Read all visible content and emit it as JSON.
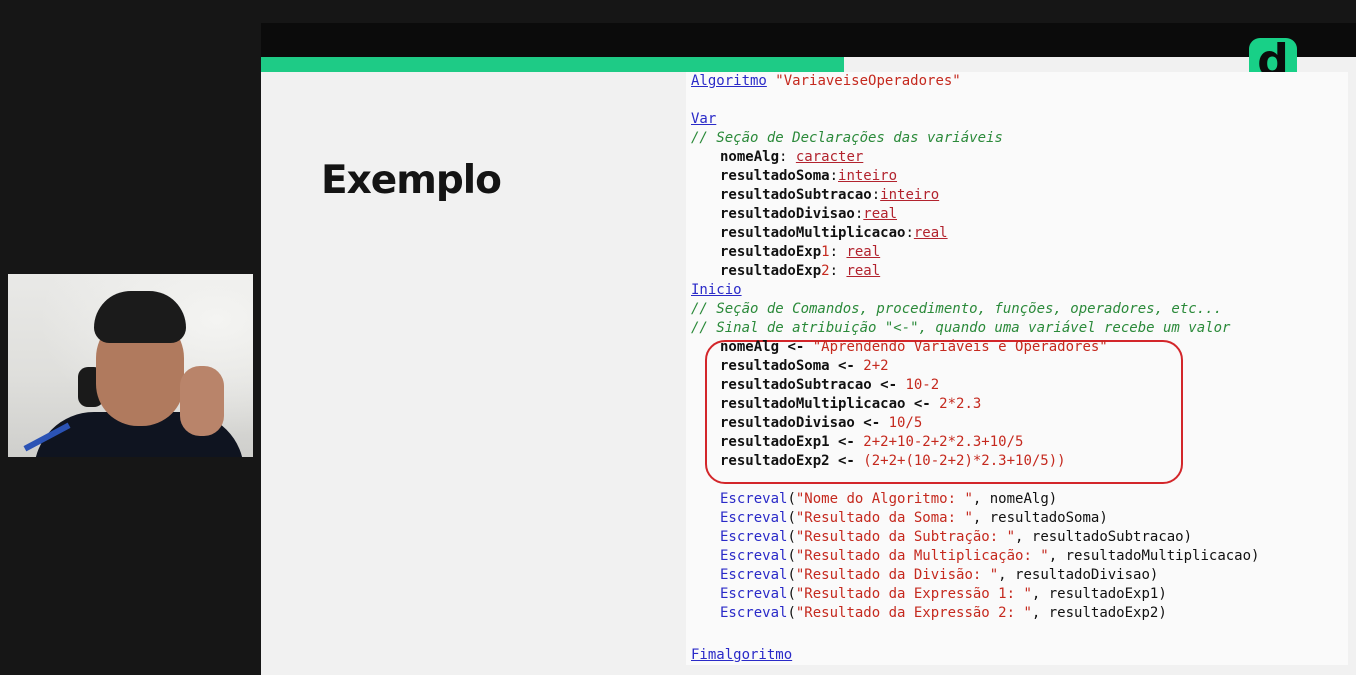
{
  "slide": {
    "title": "Exemplo",
    "logo_letter": "d",
    "colors": {
      "accent": "#1ecb86",
      "keyword": "#2a2ac8",
      "string": "#c5291e",
      "comment": "#2b8a3a",
      "highlight_box": "#d3262a"
    }
  },
  "webcam": {
    "description_icon": "presenter-webcam"
  },
  "code": {
    "algoritmo_kw": "Algoritmo",
    "algoritmo_name": "\"VariaveiseOperadores\"",
    "var_kw": "Var",
    "comment_decl": "// Seção de Declarações das variáveis",
    "decls": [
      {
        "name": "nomeAlg",
        "sep": ": ",
        "type": "caracter"
      },
      {
        "name": "resultadoSoma",
        "sep": ":",
        "type": "inteiro"
      },
      {
        "name": "resultadoSubtracao",
        "sep": ":",
        "type": "inteiro"
      },
      {
        "name": "resultadoDivisao",
        "sep": ":",
        "type": "real"
      },
      {
        "name": "resultadoMultiplicacao",
        "sep": ":",
        "type": "real"
      },
      {
        "name": "resultadoExp",
        "num": "1",
        "sep": ": ",
        "type": "real"
      },
      {
        "name": "resultadoExp",
        "num": "2",
        "sep": ": ",
        "type": "real"
      }
    ],
    "inicio_kw": "Inicio",
    "comment_cmds": "// Seção de Comandos, procedimento, funções, operadores, etc...",
    "comment_assign": "// Sinal de atribuição \"<-\", quando uma variável recebe um valor",
    "assigns": [
      {
        "lhs": "nomeAlg",
        "op": " <- ",
        "rhs": "\"Aprendendo Variáveis e Operadores\""
      },
      {
        "lhs": "resultadoSoma",
        "op": " <- ",
        "rhs": "2+2"
      },
      {
        "lhs": "resultadoSubtracao",
        "op": " <- ",
        "rhs": "10-2"
      },
      {
        "lhs": "resultadoMultiplicacao",
        "op": " <- ",
        "rhs": "2*2.3"
      },
      {
        "lhs": "resultadoDivisao",
        "op": " <- ",
        "rhs": "10/5"
      },
      {
        "lhs": "resultadoExp1",
        "op": " <- ",
        "rhs": "2+2+10-2+2*2.3+10/5"
      },
      {
        "lhs": "resultadoExp2",
        "op": " <- ",
        "rhs": "(2+2+(10-2+2)*2.3+10/5))"
      }
    ],
    "writes": [
      {
        "fn": "Escreval",
        "str": "\"Nome do Algoritmo: \"",
        "arg": "nomeAlg"
      },
      {
        "fn": "Escreval",
        "str": "\"Resultado da Soma: \"",
        "arg": "resultadoSoma"
      },
      {
        "fn": "Escreval",
        "str": "\"Resultado da Subtração: \"",
        "arg": "resultadoSubtracao"
      },
      {
        "fn": "Escreval",
        "str": "\"Resultado da Multiplicação: \"",
        "arg": "resultadoMultiplicacao"
      },
      {
        "fn": "Escreval",
        "str": "\"Resultado da Divisão: \"",
        "arg": "resultadoDivisao"
      },
      {
        "fn": "Escreval",
        "str": "\"Resultado da Expressão 1: \"",
        "arg": "resultadoExp1"
      },
      {
        "fn": "Escreval",
        "str": "\"Resultado da Expressão 2: \"",
        "arg": "resultadoExp2"
      }
    ],
    "fim_kw": "Fimalgoritmo"
  }
}
